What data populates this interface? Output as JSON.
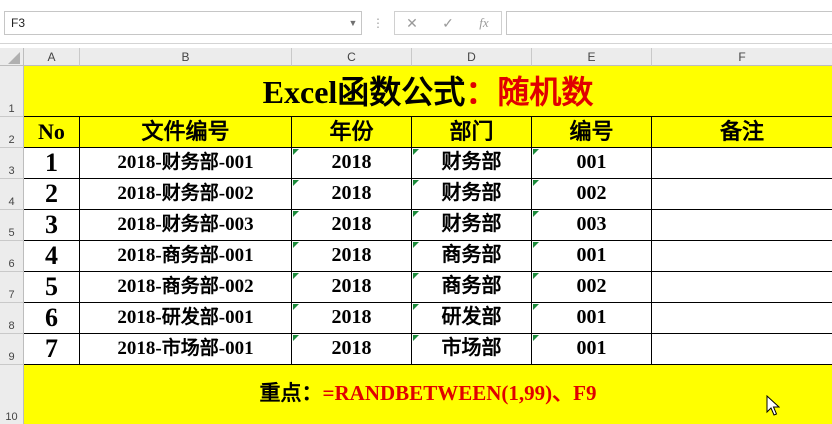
{
  "formula_bar": {
    "name_box": "F3",
    "cancel_icon": "close-icon",
    "enter_icon": "check-icon",
    "fx_label": "fx",
    "formula": ""
  },
  "columns": [
    "A",
    "B",
    "C",
    "D",
    "E",
    "F"
  ],
  "rows": [
    "1",
    "2",
    "3",
    "4",
    "5",
    "6",
    "7",
    "8",
    "9",
    "10"
  ],
  "title": {
    "black": "Excel函数公式",
    "colon": "：",
    "red": "随机数"
  },
  "table": {
    "headers": [
      "No",
      "文件编号",
      "年份",
      "部门",
      "编号",
      "备注"
    ],
    "rows": [
      [
        "1",
        "2018-财务部-001",
        "2018",
        "财务部",
        "001",
        ""
      ],
      [
        "2",
        "2018-财务部-002",
        "2018",
        "财务部",
        "002",
        ""
      ],
      [
        "3",
        "2018-财务部-003",
        "2018",
        "财务部",
        "003",
        ""
      ],
      [
        "4",
        "2018-商务部-001",
        "2018",
        "商务部",
        "001",
        ""
      ],
      [
        "5",
        "2018-商务部-002",
        "2018",
        "商务部",
        "002",
        ""
      ],
      [
        "6",
        "2018-研发部-001",
        "2018",
        "研发部",
        "001",
        ""
      ],
      [
        "7",
        "2018-市场部-001",
        "2018",
        "市场部",
        "001",
        ""
      ]
    ]
  },
  "note": {
    "label": "重点：",
    "formula": "=RANDBETWEEN(1,99)、F9"
  },
  "colors": {
    "highlight": "#ffff00",
    "accent_red": "#e00000",
    "error_marker": "#1b8a3a"
  }
}
